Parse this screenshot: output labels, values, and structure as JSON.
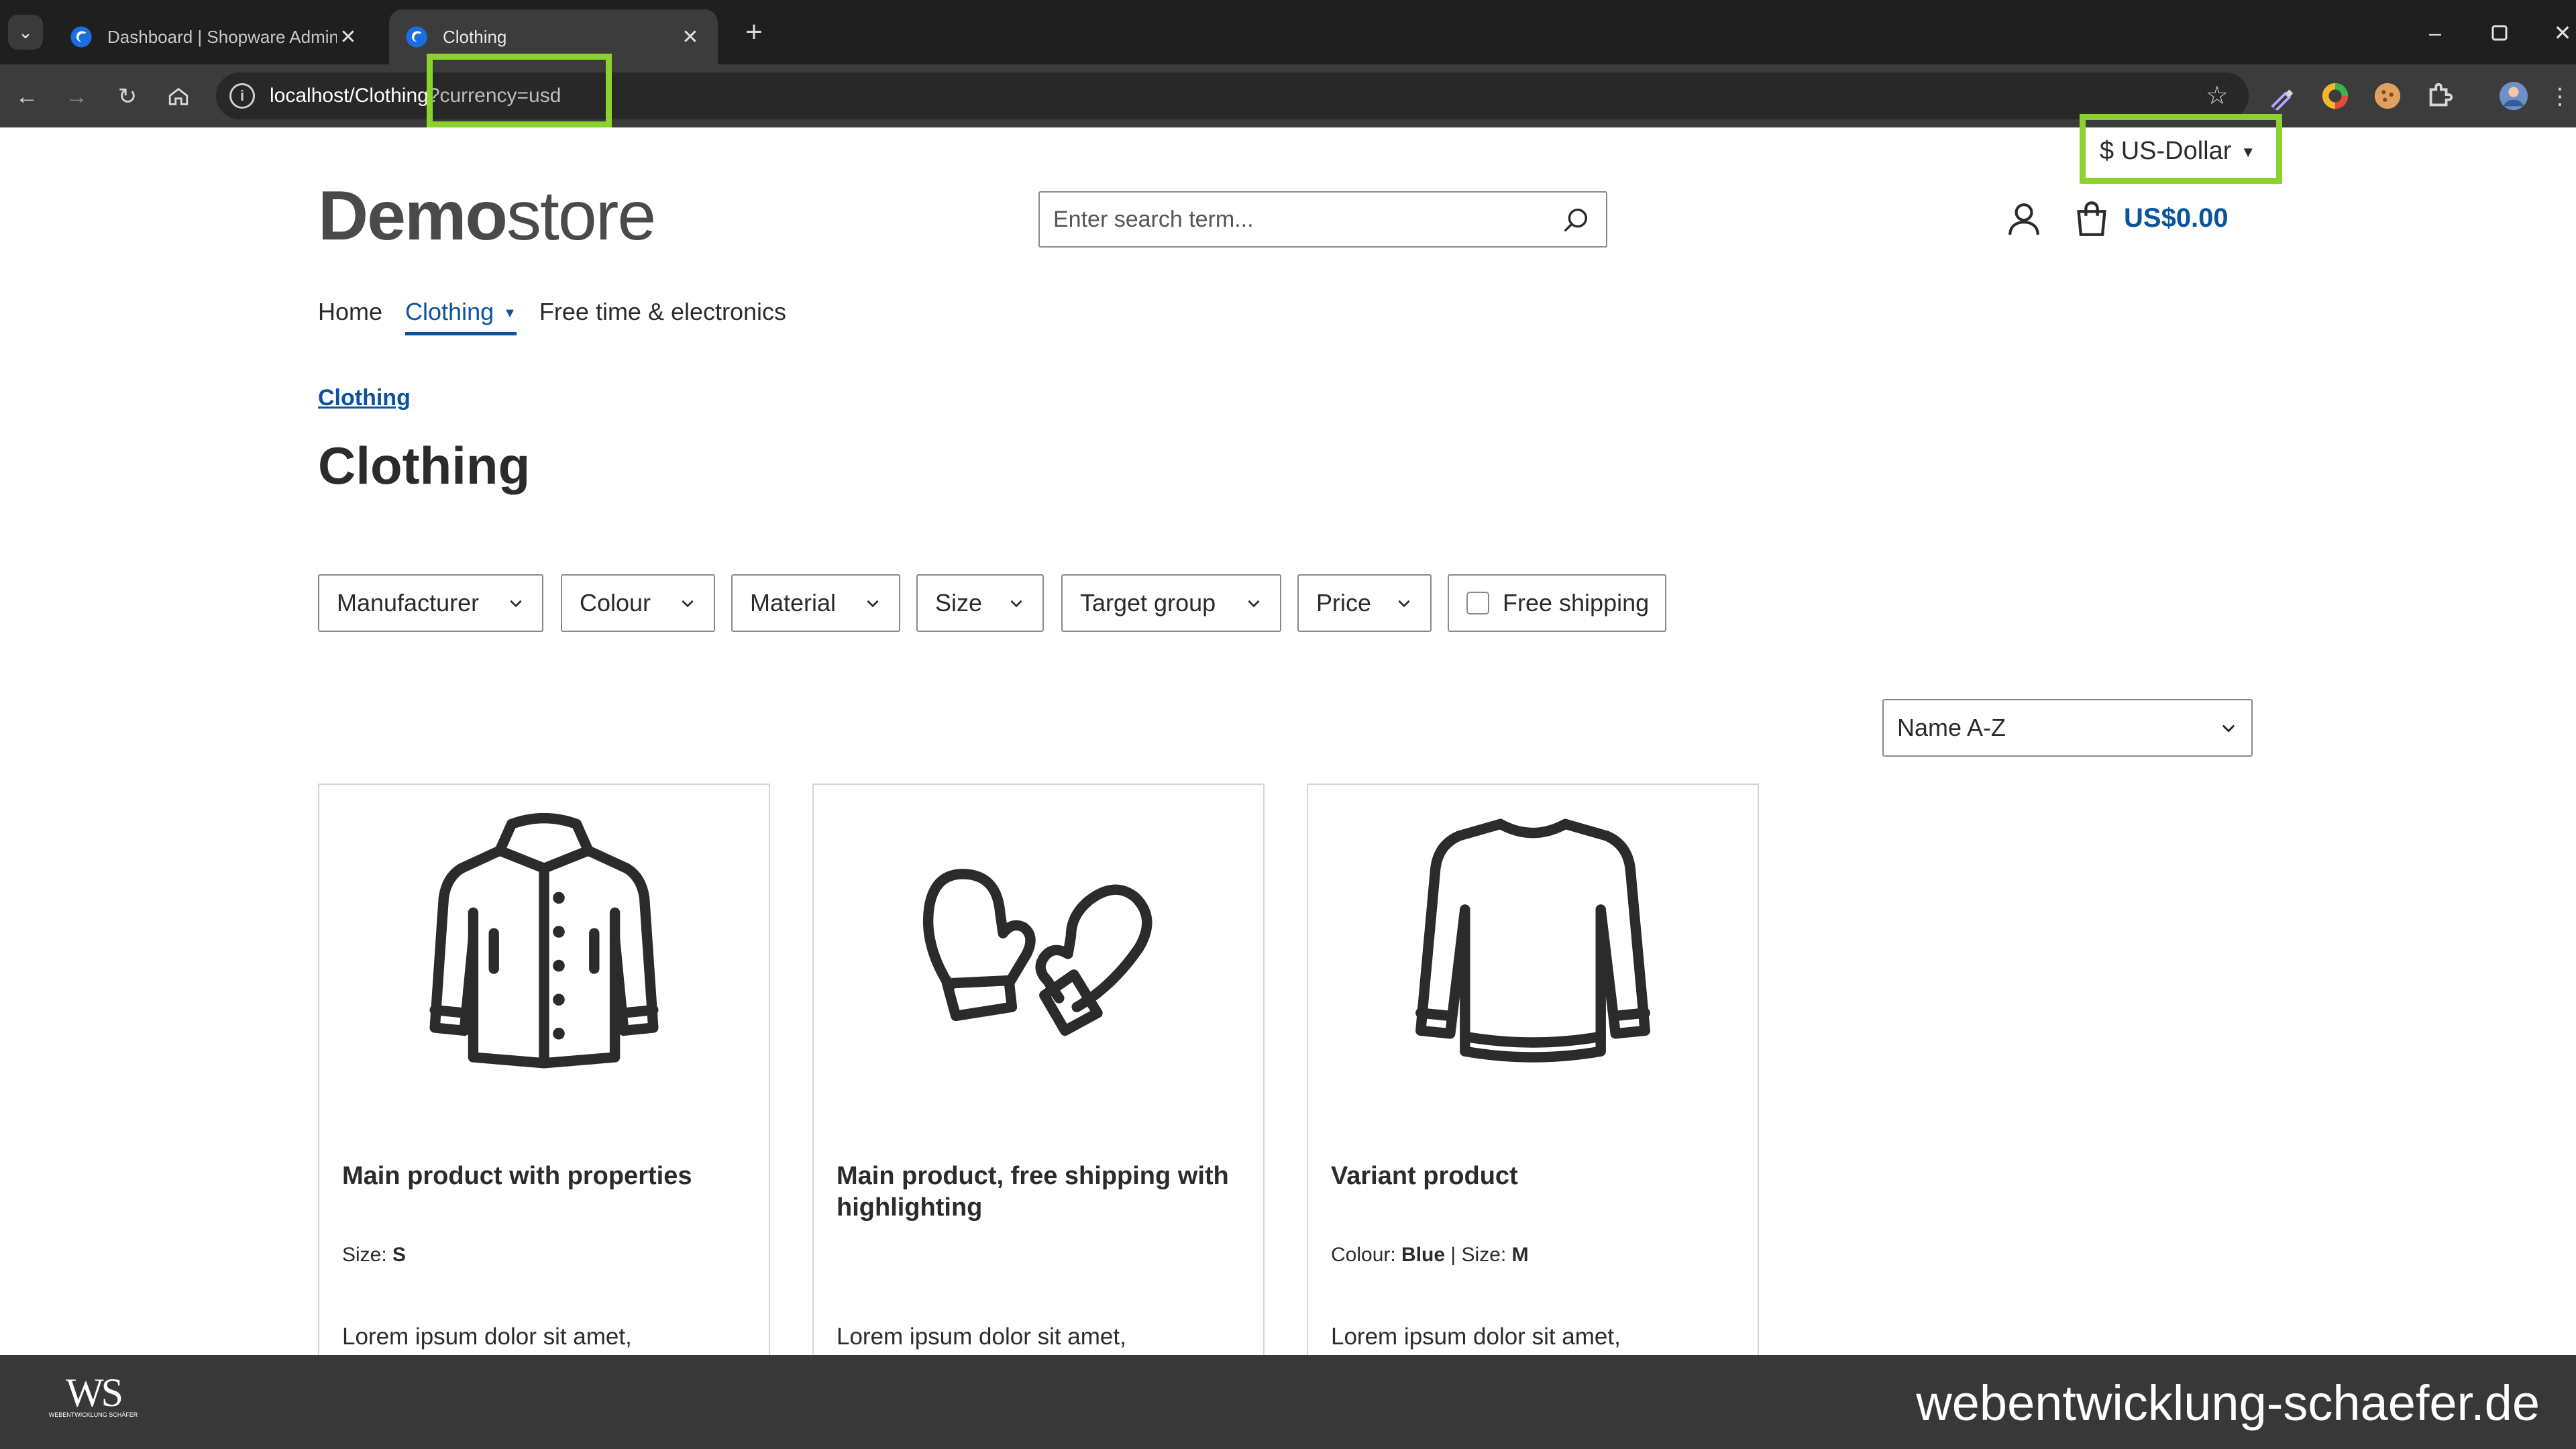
{
  "browser": {
    "tabs": [
      {
        "title": "Dashboard | Shopware Administration",
        "active": false
      },
      {
        "title": "Clothing",
        "active": true
      }
    ],
    "close_glyph": "✕",
    "new_tab_glyph": "+",
    "url_host_path": "localhost/Clothing",
    "url_query": "?currency=usd",
    "accent_color": "#8cd22e"
  },
  "header": {
    "currency_label": "$ US-Dollar",
    "logo_bold": "Demo",
    "logo_light": "store",
    "search_placeholder": "Enter search term...",
    "cart_total": "US$0.00"
  },
  "nav": {
    "items": [
      {
        "label": "Home",
        "active": false
      },
      {
        "label": "Clothing",
        "active": true
      },
      {
        "label": "Free time & electronics",
        "active": false
      }
    ]
  },
  "breadcrumb": "Clothing",
  "page_title": "Clothing",
  "filters": {
    "manufacturer": "Manufacturer",
    "colour": "Colour",
    "material": "Material",
    "size": "Size",
    "target_group": "Target group",
    "price": "Price",
    "free_shipping": "Free shipping"
  },
  "sort": {
    "selected": "Name A-Z"
  },
  "products": [
    {
      "name": "Main product with properties",
      "props": [
        {
          "key": "Size: ",
          "value": "S"
        }
      ],
      "desc": "Lorem ipsum dolor sit amet,",
      "icon": "jacket-icon"
    },
    {
      "name": "Main product, free shipping with highlighting",
      "props": [],
      "desc": "Lorem ipsum dolor sit amet,",
      "icon": "mittens-icon"
    },
    {
      "name": "Variant product",
      "props": [
        {
          "key": "Colour: ",
          "value": "Blue"
        },
        {
          "key": " | Size: ",
          "value": "M"
        }
      ],
      "desc": "Lorem ipsum dolor sit amet,",
      "icon": "sweater-icon"
    }
  ],
  "footer": {
    "logo_text": "WS",
    "logo_sub": "WEBENTWICKLUNG SCHÄFER",
    "site": "webentwicklung-schaefer.de"
  },
  "colors": {
    "brand_blue": "#0b539b",
    "text": "#2b2b2b",
    "highlight": "#8cd22e"
  }
}
